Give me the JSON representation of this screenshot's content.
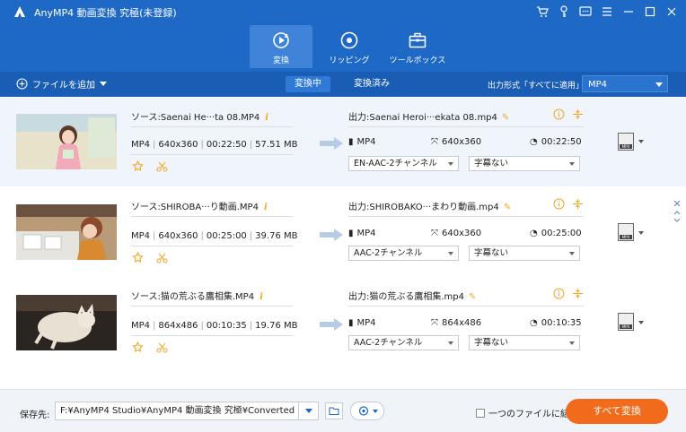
{
  "app": {
    "title": "AnyMP4 動画変換 究極(未登録)"
  },
  "tabs": [
    {
      "label": "変換",
      "icon": "convert-icon",
      "active": true
    },
    {
      "label": "リッピング",
      "icon": "ripper-icon",
      "active": false
    },
    {
      "label": "ツールボックス",
      "icon": "toolbox-icon",
      "active": false
    }
  ],
  "toolbar": {
    "add_file": "ファイルを追加",
    "subtab_converting": "変換中",
    "subtab_converted": "変換済み",
    "output_format_label": "出力形式「すべてに適用」:",
    "output_format_value": "MP4"
  },
  "files": [
    {
      "source": "ソース:Saenai He···ta 08.MP4",
      "format": "MP4",
      "resolution": "640x360",
      "duration": "00:22:50",
      "size": "57.51 MB",
      "output": "出力:Saenai Heroi···ekata 08.mp4",
      "out_format": "MP4",
      "out_resolution": "640x360",
      "out_duration": "00:22:50",
      "audio": "EN-AAC-2チャンネル",
      "subtitle": "字幕ない"
    },
    {
      "source": "ソース:SHIROBA···り動画.MP4",
      "format": "MP4",
      "resolution": "640x360",
      "duration": "00:25:00",
      "size": "39.76 MB",
      "output": "出力:SHIROBAKO···まわり動画.mp4",
      "out_format": "MP4",
      "out_resolution": "640x360",
      "out_duration": "00:25:00",
      "audio": "AAC-2チャンネル",
      "subtitle": "字幕ない"
    },
    {
      "source": "ソース:猫の荒ぶる鷹相集.MP4",
      "format": "MP4",
      "resolution": "864x486",
      "duration": "00:10:35",
      "size": "19.76 MB",
      "output": "出力:猫の荒ぶる鷹相集.mp4",
      "out_format": "MP4",
      "out_resolution": "864x486",
      "out_duration": "00:10:35",
      "audio": "AAC-2チャンネル",
      "subtitle": "字幕ない"
    }
  ],
  "bottom": {
    "save_label": "保存先:",
    "save_path": "F:¥AnyMP4 Studio¥AnyMP4 動画変換 究極¥Converted",
    "merge_label": "一つのファイルに結合",
    "convert_all": "すべて変換"
  },
  "colors": {
    "header": "#1e68c6",
    "toolbar": "#1a5db4",
    "accent": "#f26b1d",
    "icon_orange": "#f5a623"
  }
}
